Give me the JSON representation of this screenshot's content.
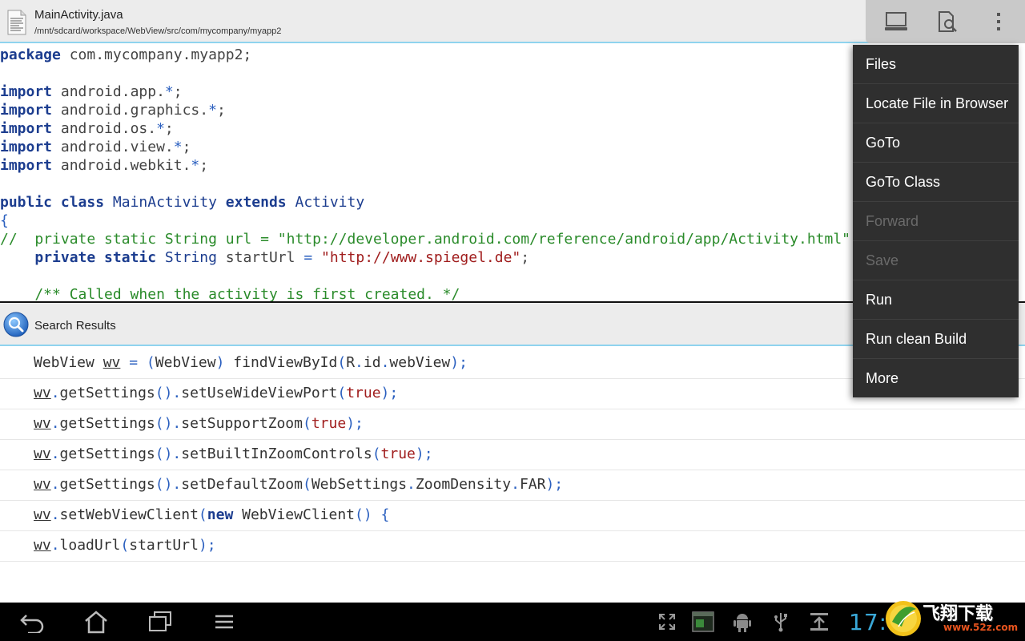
{
  "titlebar": {
    "file_name": "MainActivity.java",
    "file_path": "/mnt/sdcard/workspace/WebView/src/com/mycompany/myapp2",
    "icons": [
      "document-icon"
    ]
  },
  "actionbar": {
    "buttons": [
      "laptop-icon",
      "search-file-icon",
      "overflow-menu-icon"
    ]
  },
  "editor": {
    "lines": [
      {
        "parts": [
          [
            "kw",
            "package"
          ],
          [
            "pl",
            " com.mycompany.myapp2;"
          ]
        ]
      },
      {
        "parts": []
      },
      {
        "parts": [
          [
            "kw",
            "import"
          ],
          [
            "pl",
            " android.app."
          ],
          [
            "op",
            "*"
          ],
          [
            "pl",
            ";"
          ]
        ]
      },
      {
        "parts": [
          [
            "kw",
            "import"
          ],
          [
            "pl",
            " android.graphics."
          ],
          [
            "op",
            "*"
          ],
          [
            "pl",
            ";"
          ]
        ]
      },
      {
        "parts": [
          [
            "kw",
            "import"
          ],
          [
            "pl",
            " android.os."
          ],
          [
            "op",
            "*"
          ],
          [
            "pl",
            ";"
          ]
        ]
      },
      {
        "parts": [
          [
            "kw",
            "import"
          ],
          [
            "pl",
            " android.view."
          ],
          [
            "op",
            "*"
          ],
          [
            "pl",
            ";"
          ]
        ]
      },
      {
        "parts": [
          [
            "kw",
            "import"
          ],
          [
            "pl",
            " android.webkit."
          ],
          [
            "op",
            "*"
          ],
          [
            "pl",
            ";"
          ]
        ]
      },
      {
        "parts": []
      },
      {
        "parts": [
          [
            "kw",
            "public class "
          ],
          [
            "ty",
            "MainActivity"
          ],
          [
            "kw",
            " extends "
          ],
          [
            "ty",
            "Activity"
          ]
        ]
      },
      {
        "parts": [
          [
            "op",
            "{"
          ]
        ]
      },
      {
        "parts": [
          [
            "cm",
            "//  private static String url = \"http://developer.android.com/reference/android/app/Activity.html\";"
          ]
        ]
      },
      {
        "parts": [
          [
            "pl",
            "    "
          ],
          [
            "kw",
            "private static "
          ],
          [
            "ty",
            "String"
          ],
          [
            "pl",
            " startUrl "
          ],
          [
            "op",
            "="
          ],
          [
            "pl",
            " "
          ],
          [
            "st",
            "\"http://www.spiegel.de\""
          ],
          [
            "pl",
            ";"
          ]
        ]
      },
      {
        "parts": []
      },
      {
        "parts": [
          [
            "cm",
            "    /** Called when the activity is first created. */"
          ]
        ]
      }
    ]
  },
  "search_results": {
    "title": "Search Results",
    "rows": [
      [
        [
          "pl",
          "WebView "
        ],
        [
          "u",
          "wv"
        ],
        [
          "op",
          " = ("
        ],
        [
          "pl",
          "WebView"
        ],
        [
          "op",
          ") "
        ],
        [
          "pl",
          "findViewById"
        ],
        [
          "op",
          "("
        ],
        [
          "pl",
          "R"
        ],
        [
          "op",
          "."
        ],
        [
          "pl",
          "id"
        ],
        [
          "op",
          "."
        ],
        [
          "pl",
          "webView"
        ],
        [
          "op",
          ");"
        ]
      ],
      [
        [
          "u",
          "wv"
        ],
        [
          "op",
          "."
        ],
        [
          "pl",
          "getSettings"
        ],
        [
          "op",
          "()."
        ],
        [
          "pl",
          "setUseWideViewPort"
        ],
        [
          "op",
          "("
        ],
        [
          "st",
          "true"
        ],
        [
          "op",
          ");"
        ]
      ],
      [
        [
          "u",
          "wv"
        ],
        [
          "op",
          "."
        ],
        [
          "pl",
          "getSettings"
        ],
        [
          "op",
          "()."
        ],
        [
          "pl",
          "setSupportZoom"
        ],
        [
          "op",
          "("
        ],
        [
          "st",
          "true"
        ],
        [
          "op",
          ");"
        ]
      ],
      [
        [
          "u",
          "wv"
        ],
        [
          "op",
          "."
        ],
        [
          "pl",
          "getSettings"
        ],
        [
          "op",
          "()."
        ],
        [
          "pl",
          "setBuiltInZoomControls"
        ],
        [
          "op",
          "("
        ],
        [
          "st",
          "true"
        ],
        [
          "op",
          ");"
        ]
      ],
      [
        [
          "u",
          "wv"
        ],
        [
          "op",
          "."
        ],
        [
          "pl",
          "getSettings"
        ],
        [
          "op",
          "()."
        ],
        [
          "pl",
          "setDefaultZoom"
        ],
        [
          "op",
          "("
        ],
        [
          "pl",
          "WebSettings"
        ],
        [
          "op",
          "."
        ],
        [
          "pl",
          "ZoomDensity"
        ],
        [
          "op",
          "."
        ],
        [
          "pl",
          "FAR"
        ],
        [
          "op",
          ");"
        ]
      ],
      [
        [
          "u",
          "wv"
        ],
        [
          "op",
          "."
        ],
        [
          "pl",
          "setWebViewClient"
        ],
        [
          "op",
          "("
        ],
        [
          "kw",
          "new"
        ],
        [
          "pl",
          " WebViewClient"
        ],
        [
          "op",
          "() {"
        ]
      ],
      [
        [
          "u",
          "wv"
        ],
        [
          "op",
          "."
        ],
        [
          "pl",
          "loadUrl"
        ],
        [
          "op",
          "("
        ],
        [
          "pl",
          "startUrl"
        ],
        [
          "op",
          ");"
        ]
      ]
    ]
  },
  "menu": {
    "items": [
      {
        "label": "Files",
        "enabled": true
      },
      {
        "label": "Locate File in Browser",
        "enabled": true
      },
      {
        "label": "GoTo",
        "enabled": true
      },
      {
        "label": "GoTo Class",
        "enabled": true
      },
      {
        "label": "Forward",
        "enabled": false
      },
      {
        "label": "Save",
        "enabled": false
      },
      {
        "label": "Run",
        "enabled": true
      },
      {
        "label": "Run clean Build",
        "enabled": true
      },
      {
        "label": "More",
        "enabled": true
      }
    ]
  },
  "system_bar": {
    "nav": [
      "back-icon",
      "home-icon",
      "recent-apps-icon",
      "menu-icon"
    ],
    "tray": [
      "fullscreen-icon",
      "screenshot-icon",
      "android-debug-icon",
      "usb-icon",
      "download-icon"
    ],
    "clock": "17:4"
  },
  "watermark": {
    "text": "飞翔下载",
    "url": "www.52z.com"
  },
  "colors": {
    "accent": "#8fd3ee",
    "keyword": "#1c3d8f",
    "comment": "#2a8b2a",
    "string": "#a01d1d",
    "menu_bg": "#2f2f2f",
    "clock": "#3aa8d8"
  }
}
